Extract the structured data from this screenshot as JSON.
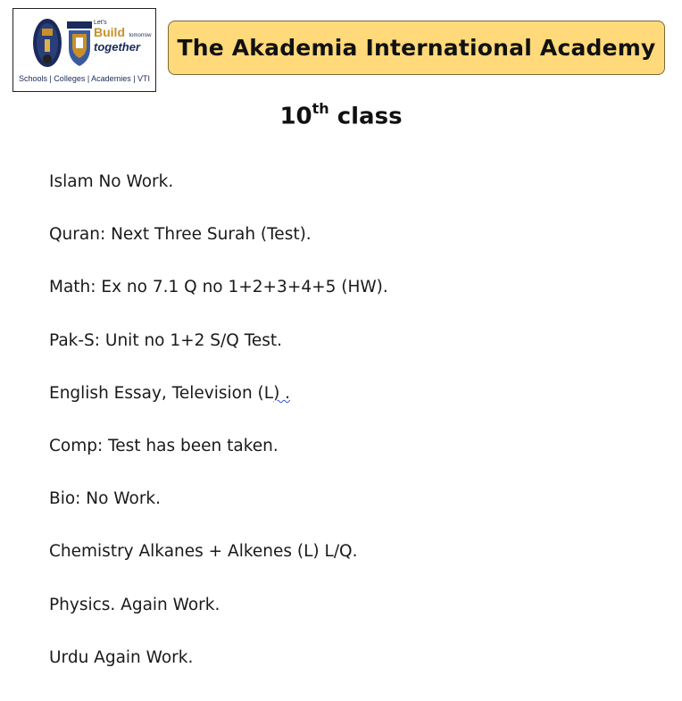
{
  "logo": {
    "icon": "school-crest-logo",
    "tagline_lines": [
      "Let's",
      "Build",
      "tomorrow",
      "together"
    ],
    "footer": "Schools | Colleges | Academies | VTI",
    "colors": {
      "navy": "#1a2a5a",
      "gold": "#c8902a",
      "blue": "#3a5aa0"
    }
  },
  "header": {
    "title": "The Akademia International Academy",
    "banner_color": "#ffd97a"
  },
  "class_title": {
    "number": "10",
    "suffix": "th",
    "label": "class"
  },
  "items": [
    "Islam No Work.",
    "Quran: Next Three Surah (Test).",
    "Math: Ex no 7.1 Q no 1+2+3+4+5 (HW).",
    "Pak-S: Unit no 1+2 S/Q Test.",
    {
      "main": "English Essay, Television (L",
      "marked": ") .",
      "tail": ""
    },
    "Comp: Test has been taken.",
    "Bio: No Work.",
    "Chemistry Alkanes + Alkenes (L) L/Q.",
    "Physics. Again Work.",
    "Urdu Again Work."
  ]
}
